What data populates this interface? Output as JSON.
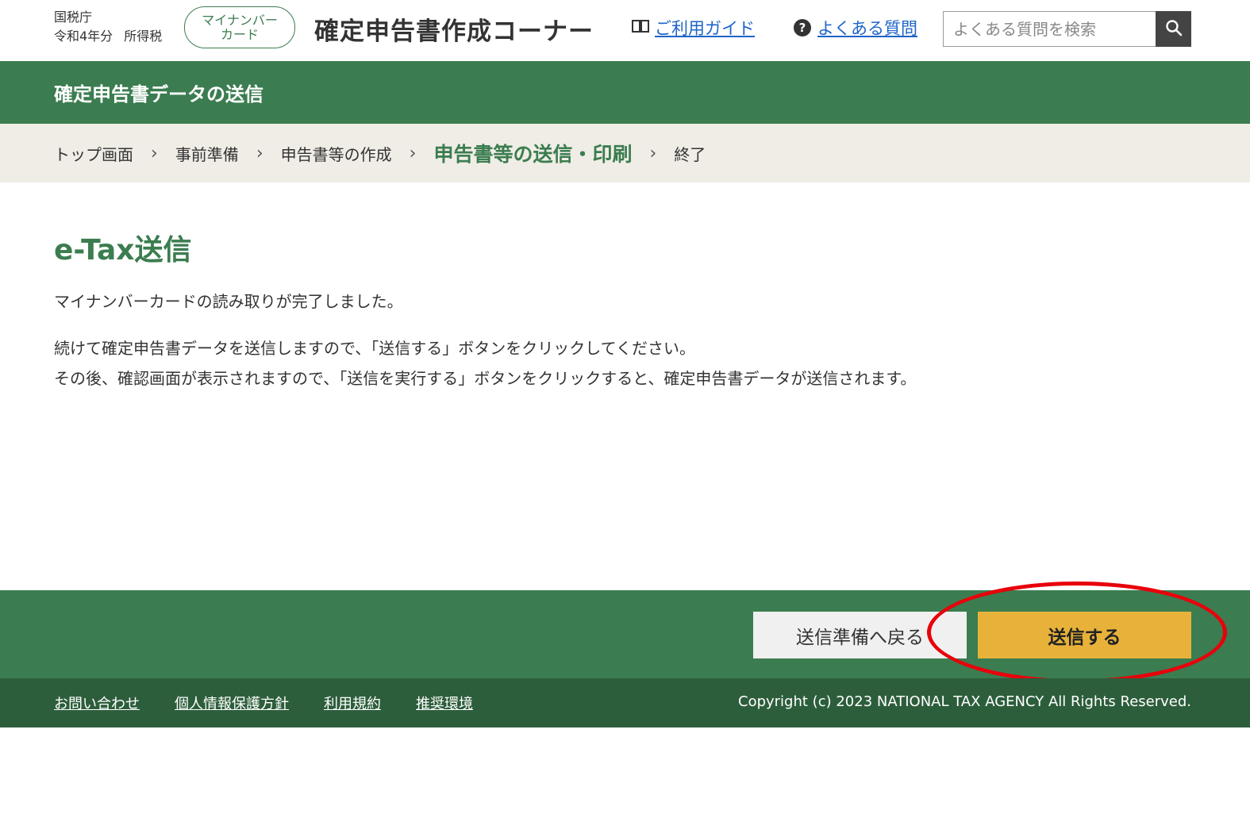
{
  "header": {
    "agency": "国税庁",
    "fiscal_year": "令和4年分",
    "tax_type": "所得税",
    "mynumber_badge_line1": "マイナンバー",
    "mynumber_badge_line2": "カード",
    "app_title": "確定申告書作成コーナー",
    "guide_link": "ご利用ガイド",
    "faq_link": "よくある質問",
    "search_placeholder": "よくある質問を検索"
  },
  "section": {
    "title": "確定申告書データの送信"
  },
  "breadcrumb": {
    "items": [
      "トップ画面",
      "事前準備",
      "申告書等の作成",
      "申告書等の送信・印刷",
      "終了"
    ],
    "current_index": 3,
    "separator": "›"
  },
  "main": {
    "title": "e-Tax送信",
    "message1": "マイナンバーカードの読み取りが完了しました。",
    "message2": "続けて確定申告書データを送信しますので、「送信する」ボタンをクリックしてください。",
    "message3": "その後、確認画面が表示されますので、「送信を実行する」ボタンをクリックすると、確定申告書データが送信されます。"
  },
  "actions": {
    "back_label": "送信準備へ戻る",
    "send_label": "送信する"
  },
  "footer": {
    "links": [
      "お問い合わせ",
      "個人情報保護方針",
      "利用規約",
      "推奨環境"
    ],
    "copyright": "Copyright (c) 2023 NATIONAL TAX AGENCY All Rights Reserved."
  },
  "colors": {
    "brand_green": "#3b7d50",
    "footer_green": "#2d5e3c",
    "send_button": "#e8b23a",
    "highlight": "#e8000b",
    "link_blue": "#1e64c8"
  },
  "icons": {
    "guide": "book-icon",
    "faq": "question-icon",
    "search": "search-icon"
  }
}
